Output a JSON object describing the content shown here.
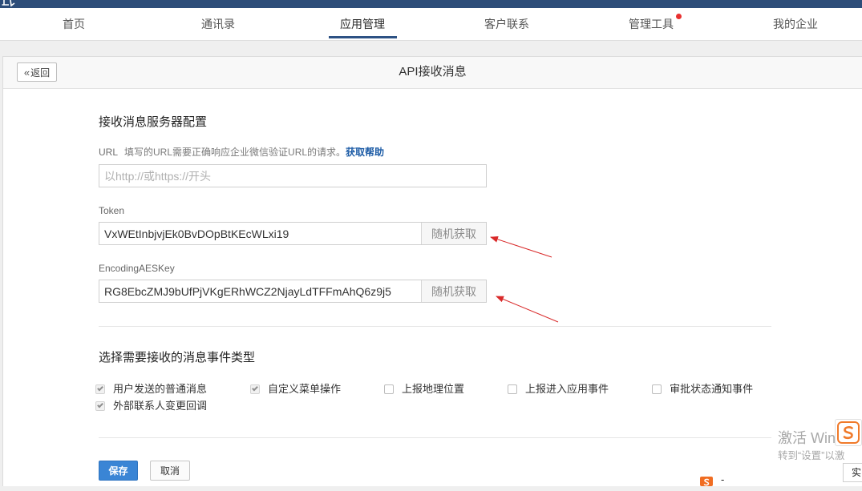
{
  "nav": {
    "tabs": [
      {
        "label": "首页",
        "active": false,
        "badge_dot": false
      },
      {
        "label": "通讯录",
        "active": false,
        "badge_dot": false
      },
      {
        "label": "应用管理",
        "active": true,
        "badge_dot": false
      },
      {
        "label": "客户联系",
        "active": false,
        "badge_dot": false
      },
      {
        "label": "管理工具",
        "active": false,
        "badge_dot": true
      },
      {
        "label": "我的企业",
        "active": false,
        "badge_dot": false
      }
    ]
  },
  "panel": {
    "back": {
      "icon": "double-chevron-left-icon",
      "label": "返回"
    },
    "title": "API接收消息"
  },
  "server_config": {
    "heading": "接收消息服务器配置",
    "url": {
      "label": "URL",
      "hint": "填写的URL需要正确响应企业微信验证URL的请求。",
      "help_link": "获取帮助",
      "value": "",
      "placeholder": "以http://或https://开头"
    },
    "token": {
      "label": "Token",
      "value": "VxWEtInbjvjEk0BvDOpBtKEcWLxi19",
      "random_button": "随机获取"
    },
    "encoding_aes_key": {
      "label": "EncodingAESKey",
      "value": "RG8EbcZMJ9bUfPjVKgERhWCZ2NjayLdTFFmAhQ6z9j5",
      "random_button": "随机获取"
    }
  },
  "event_types": {
    "heading": "选择需要接收的消息事件类型",
    "options": [
      {
        "label": "用户发送的普通消息",
        "checked": true
      },
      {
        "label": "自定义菜单操作",
        "checked": true
      },
      {
        "label": "上报地理位置",
        "checked": false
      },
      {
        "label": "上报进入应用事件",
        "checked": false
      },
      {
        "label": "审批状态通知事件",
        "checked": false
      },
      {
        "label": "外部联系人变更回调",
        "checked": true
      }
    ]
  },
  "actions": {
    "save_label": "保存",
    "cancel_label": "取消"
  },
  "system_overlay": {
    "watermark_line1": "激活 Windo",
    "watermark_line2": "转到“设置”以激",
    "ime_icon": "sogou-ime-icon",
    "ime_mode_label": "实",
    "ime_status_text": "-"
  },
  "colors": {
    "topbar": "#2d4d79",
    "accent": "#2d5284",
    "notification_dot": "#e8302f",
    "link": "#1d5ca6",
    "primary_button": "#3a85d5",
    "annotation_arrow": "#d92a2a"
  }
}
